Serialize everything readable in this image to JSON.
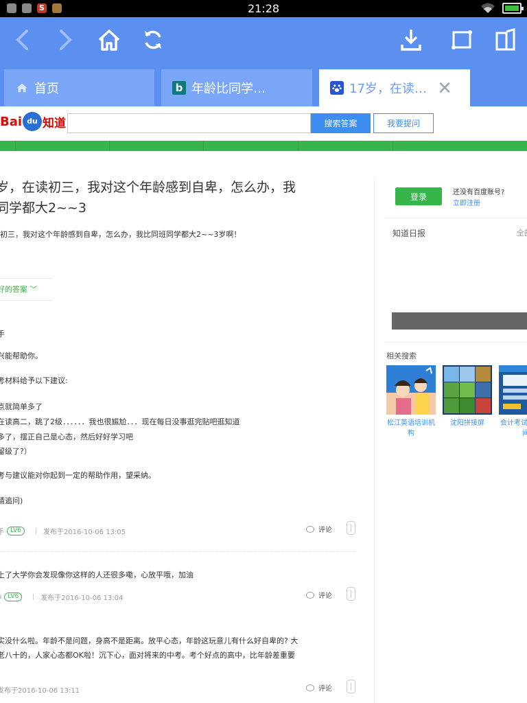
{
  "status_bar": {
    "time": "21:28"
  },
  "tabs": [
    {
      "label": "首页"
    },
    {
      "label": "年龄比同学…"
    },
    {
      "label": "17岁，在读…"
    }
  ],
  "header": {
    "logo_bai": "Bai",
    "logo_du": "du",
    "logo_zhidao": "知道",
    "search_value": "",
    "search_button": "搜索答案",
    "ask_button": "我要提问"
  },
  "question": {
    "title_line1": "岁，在读初三，我对这个年龄感到自卑，怎么办，我",
    "title_line2": "同学都大2~~3",
    "description": "初三，我对这个年龄感到自卑，怎么办，我比同班同学都大2~~3岁啊！"
  },
  "best_answer": {
    "label": "好的答案",
    "lines": [
      "手",
      "兴能帮助你。",
      "考材料给予以下建议:",
      "点就简单多了",
      "在读高二，跳了2级．．．．．．我也很尴尬．．．现在每日没事逛完贴吧逛知道",
      "多了，摆正自己是心态，然后好好学习吧",
      "留级了?）",
      "考与建议能对你起到一定的帮助作用，望采纳。",
      "请追问)"
    ],
    "meta_user": "手",
    "meta_level": "LV6",
    "meta_time": "发布于2016-10-06  13:05",
    "comment": "评论"
  },
  "replies": [
    {
      "text": "上了大学你会发现像你这样的人还很多嘞，心放平哦，加油",
      "meta_user": "u",
      "meta_level": "LV6",
      "meta_time": "发布于2016-10-06  13:04",
      "comment": "评论"
    },
    {
      "text_line1": "实没什么啦。年龄不是问题，身高不是距离。放平心态，年龄这玩意儿有什么好自卑的? 大",
      "text_line2": "老八十的，人家心态都OK啦！沉下心，面对将来的中考。考个好点的高中，比年龄差重要",
      "meta_time": "发布于2016-10-06  13:11",
      "comment": "评论"
    }
  ],
  "sidebar": {
    "login_button": "登录",
    "no_account": "还没有百度账号?",
    "register": "立即注册",
    "daily_title": "知道日报",
    "daily_more": "全部",
    "related_title": "相关搜索",
    "related": [
      {
        "caption_1": "松江英语培训机",
        "caption_2": "构"
      },
      {
        "caption_1": "沈阳拼接屏",
        "caption_2": ""
      },
      {
        "caption_1": "会计考试",
        "caption_2": "间"
      }
    ]
  }
}
